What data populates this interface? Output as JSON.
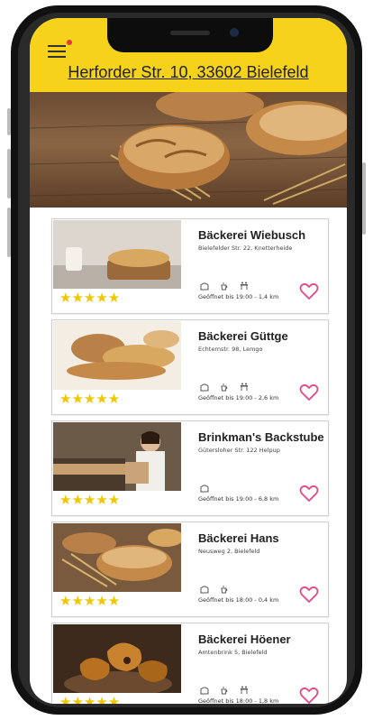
{
  "header": {
    "address": "Herforder Str. 10, 33602 Bielefeld",
    "accent_color": "#f7d21a",
    "notification_color": "#e53935"
  },
  "hero": {
    "image": "bread-on-wood-icon"
  },
  "bakeries": [
    {
      "name": "Bäckerei Wiebusch",
      "address": "Bielefelder Str. 22, Knetterheide",
      "status": "Geöffnet bis 19:00 - 1,4 km",
      "stars": "★★★★★",
      "services": [
        "bread-icon",
        "coffee-cup-icon",
        "seating-icon"
      ]
    },
    {
      "name": "Bäckerei Güttge",
      "address": "Echternstr. 98, Lemgo",
      "status": "Geöffnet bis 19:00 - 2,6 km",
      "stars": "★★★★★",
      "services": [
        "bread-icon",
        "coffee-cup-icon",
        "seating-icon"
      ]
    },
    {
      "name": "Brinkman's Backstube",
      "address": "Gütersloher Str. 122 Helpup",
      "status": "Geöffnet bis 19:00 - 6,8 km",
      "stars": "★★★★★",
      "services": [
        "bread-icon"
      ]
    },
    {
      "name": "Bäckerei Hans",
      "address": "Neusweg 2, Bielefeld",
      "status": "Geöffnet bis 18:00 - 0,4 km",
      "stars": "★★★★★",
      "services": [
        "bread-icon",
        "coffee-cup-icon"
      ]
    },
    {
      "name": "Bäckerei Höener",
      "address": "Amtenbrink 5, Bielefeld",
      "status": "Geöffnet bis 18:00 - 1,8 km",
      "stars": "★★★★★",
      "services": [
        "bread-icon",
        "coffee-cup-icon",
        "seating-icon"
      ]
    }
  ]
}
